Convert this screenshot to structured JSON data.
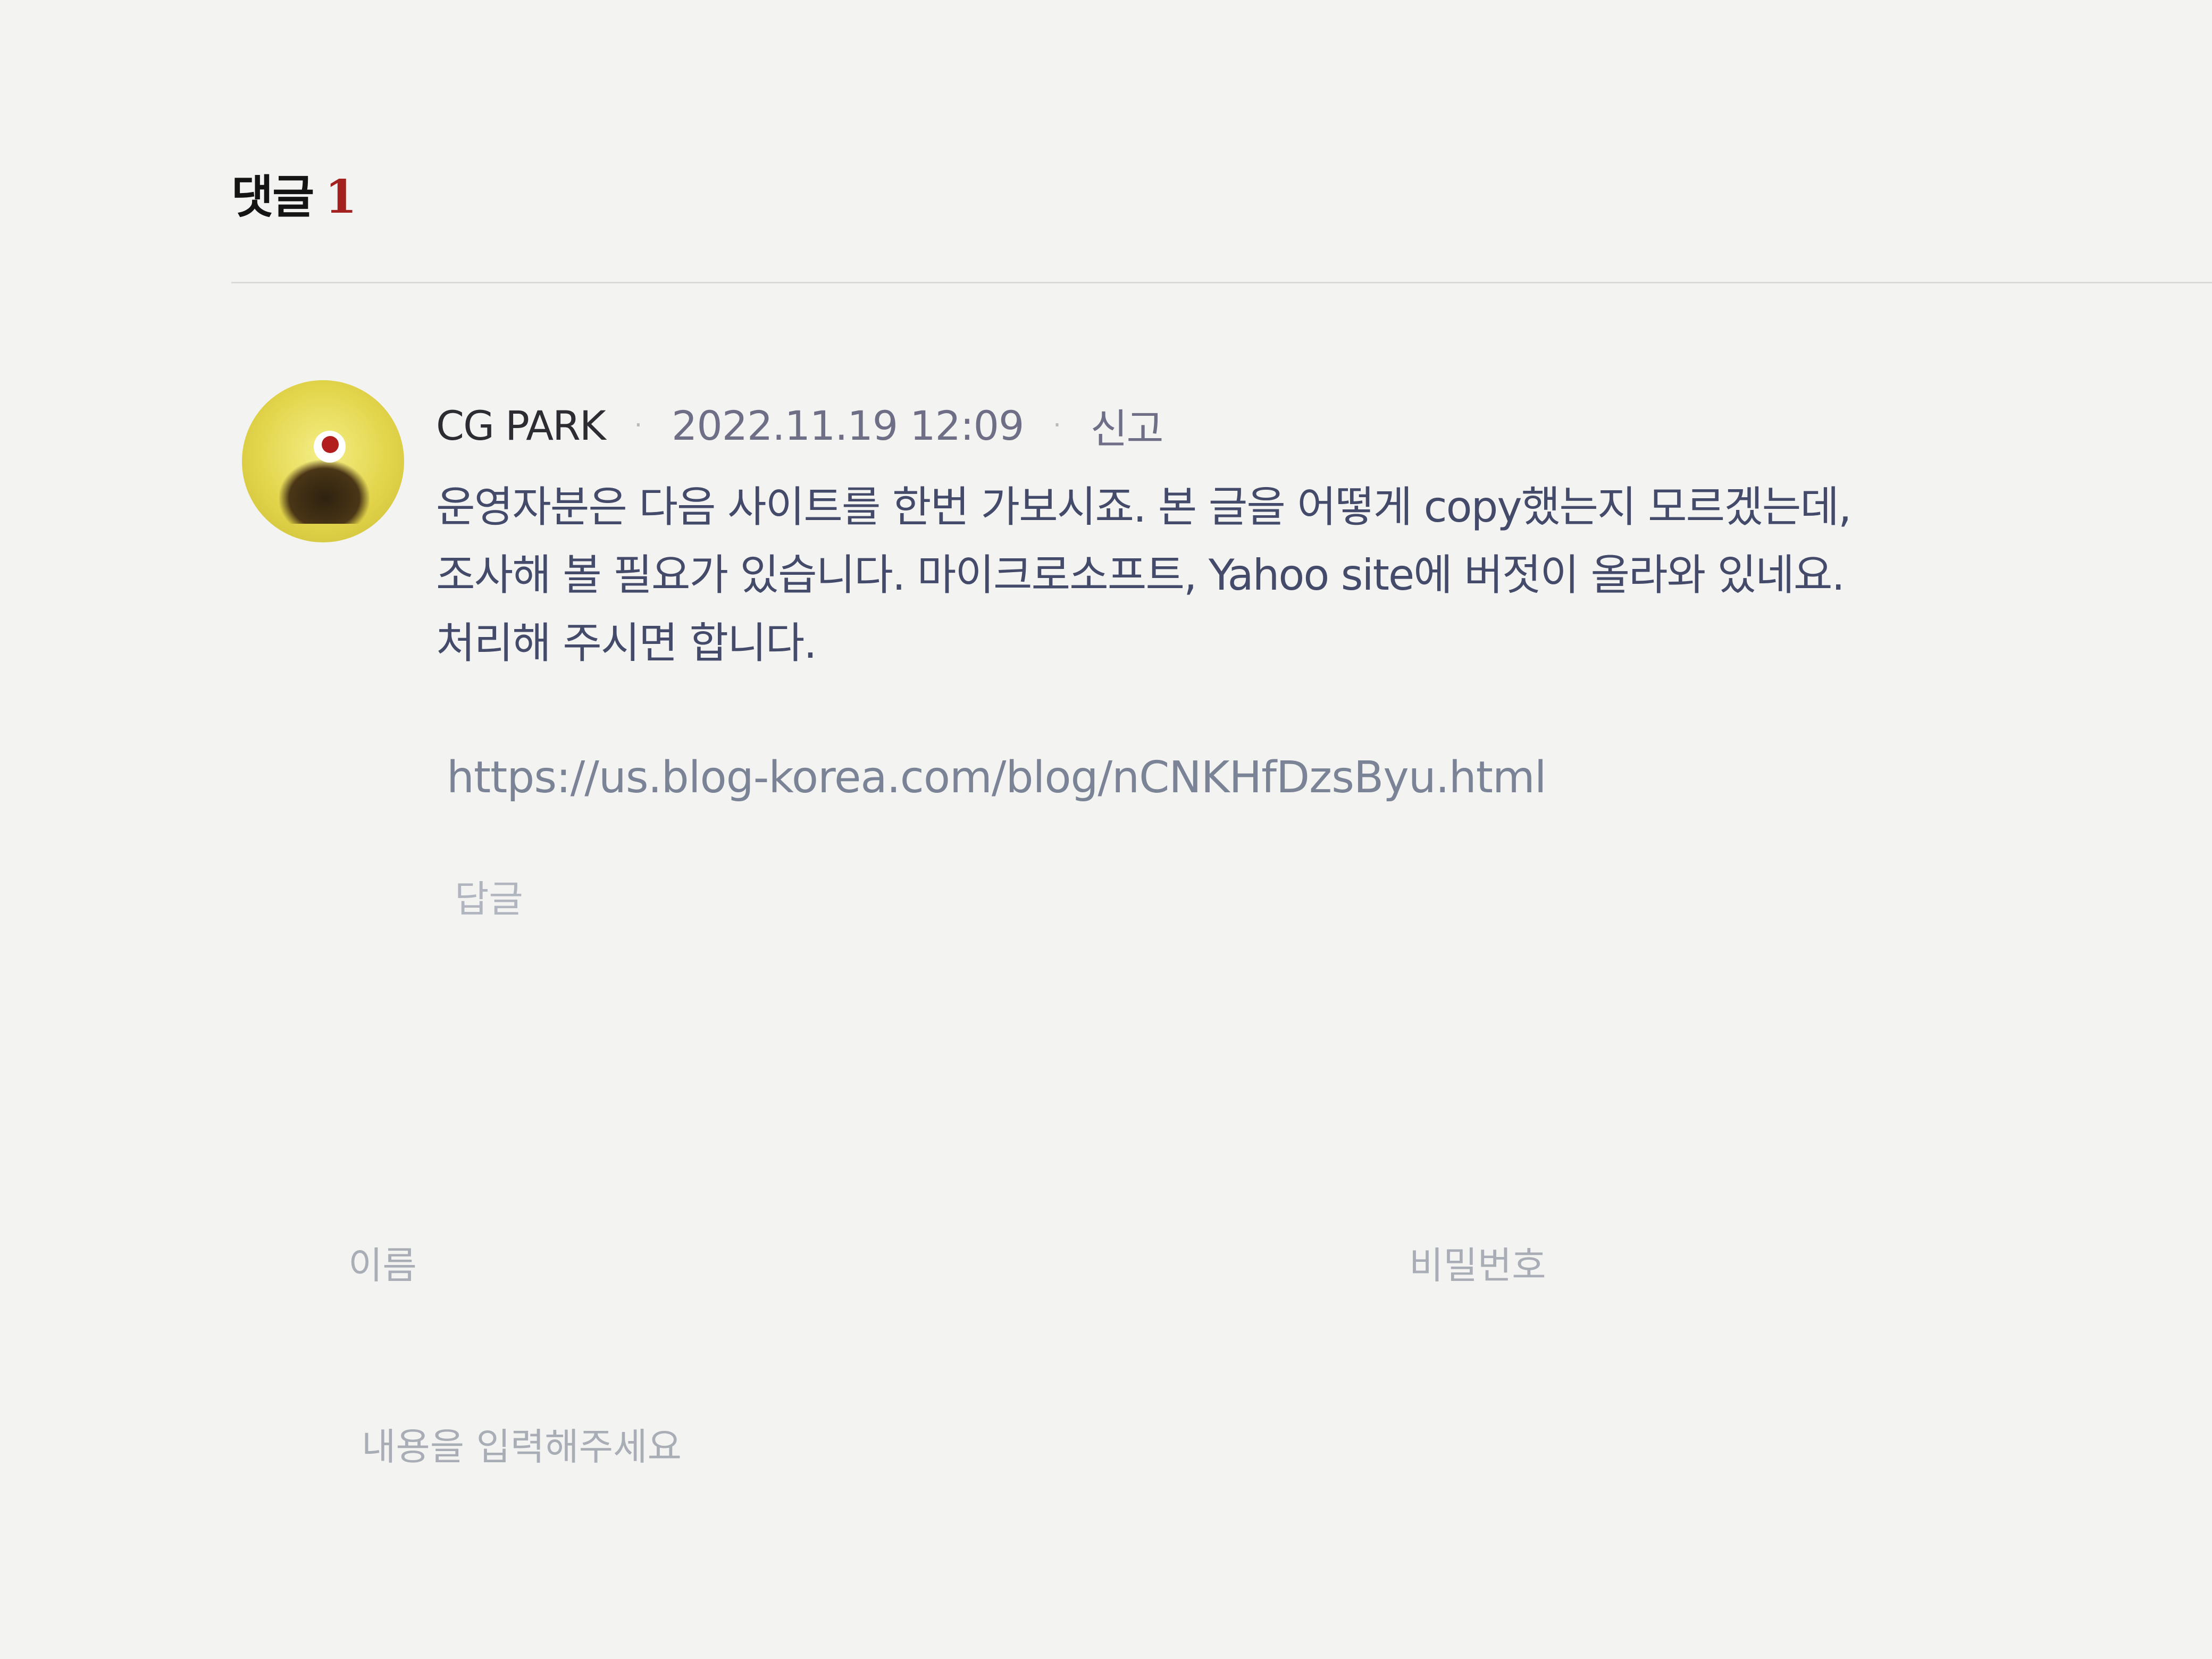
{
  "comments": {
    "heading": "댓글",
    "count": "1"
  },
  "comment": {
    "author": "CG PARK",
    "separator": "·",
    "date": "2022.11.19 12:09",
    "report_label": "신고",
    "body_lines": [
      "운영자분은 다음 사이트를 한번 가보시죠. 본 글을 어떻게 copy했는지 모르겠는데,",
      "조사해 볼 필요가 있습니다. 마이크로소프트, Yahoo site에 버젓이 올라와 있네요.",
      "처리해 주시면 합니다."
    ],
    "link": "https://us.blog-korea.com/blog/nCNKHfDzsByu.html",
    "reply_label": "답글"
  },
  "form": {
    "name_placeholder": "이름",
    "password_placeholder": "비밀번호",
    "content_placeholder": "내용을 입력해주세요"
  },
  "colors": {
    "count_accent": "#a3221f",
    "background": "#f3f3f1",
    "body_text": "#444b6a"
  }
}
